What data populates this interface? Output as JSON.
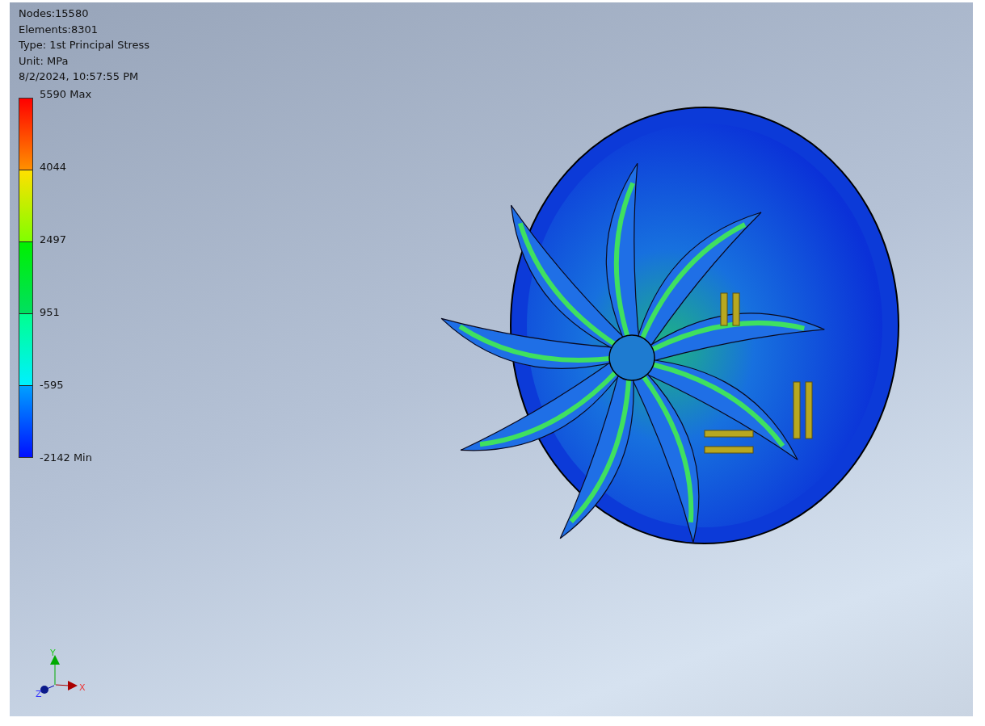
{
  "info": [
    "Nodes:15580",
    "Elements:8301",
    "Type: 1st Principal Stress",
    "Unit: MPa",
    "8/2/2024, 10:57:55 PM"
  ],
  "legend": {
    "labels": [
      "5590 Max",
      "4044",
      "2497",
      "951",
      "-595",
      "-2142 Min"
    ]
  },
  "axes": {
    "x": "X",
    "y": "Y",
    "z": "Z"
  }
}
